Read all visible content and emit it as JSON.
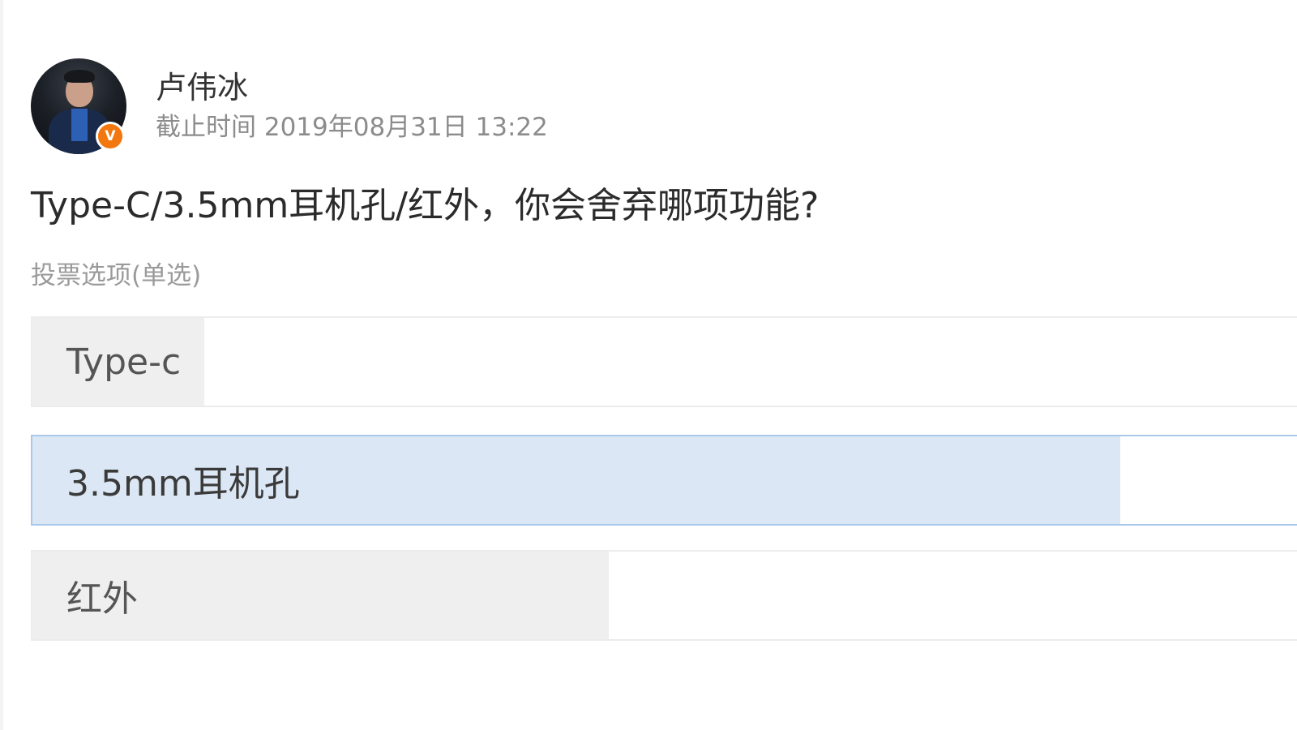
{
  "author": {
    "name": "卢伟冰",
    "verified_badge": "V",
    "deadline": "截止时间 2019年08月31日 13:22"
  },
  "poll": {
    "question": "Type-C/3.5mm耳机孔/红外，你会舍弃哪项功能?",
    "vote_type": "投票选项(单选)",
    "options": [
      {
        "label": "Type-c",
        "share": 0.136,
        "selected": false
      },
      {
        "label": "3.5mm耳机孔",
        "share": 0.86,
        "selected": true
      },
      {
        "label": "红外",
        "share": 0.456,
        "selected": false
      }
    ]
  },
  "colors": {
    "option_fill": "#efefef",
    "selected_fill": "#dbe7f4",
    "selected_border": "#a9c9ea",
    "badge": "#f2770e"
  }
}
